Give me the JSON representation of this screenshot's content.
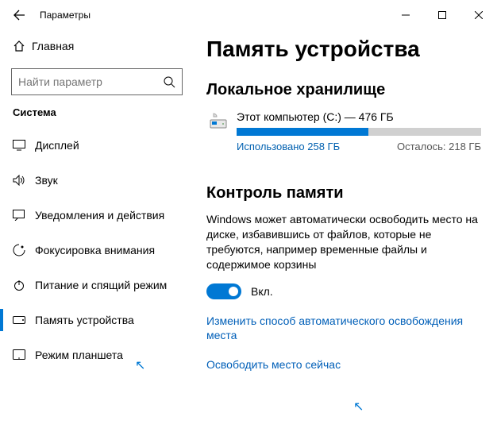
{
  "titlebar": {
    "title": "Параметры"
  },
  "sidebar": {
    "home": "Главная",
    "search_placeholder": "Найти параметр",
    "section": "Система",
    "items": [
      {
        "label": "Дисплей"
      },
      {
        "label": "Звук"
      },
      {
        "label": "Уведомления и действия"
      },
      {
        "label": "Фокусировка внимания"
      },
      {
        "label": "Питание и спящий режим"
      },
      {
        "label": "Память устройства"
      },
      {
        "label": "Режим планшета"
      }
    ]
  },
  "main": {
    "title": "Память устройства",
    "storage_heading": "Локальное хранилище",
    "drive": {
      "name": "Этот компьютер (C:) — 476 ГБ",
      "used": "Использовано 258 ГБ",
      "free": "Осталось: 218 ГБ"
    },
    "sense_heading": "Контроль памяти",
    "sense_desc": "Windows может автоматически освободить место на диске, избавившись от файлов, которые не требуются, например временные файлы и содержимое корзины",
    "toggle_label": "Вкл.",
    "link1": "Изменить способ автоматического освобождения места",
    "link2": "Освободить место сейчас"
  }
}
